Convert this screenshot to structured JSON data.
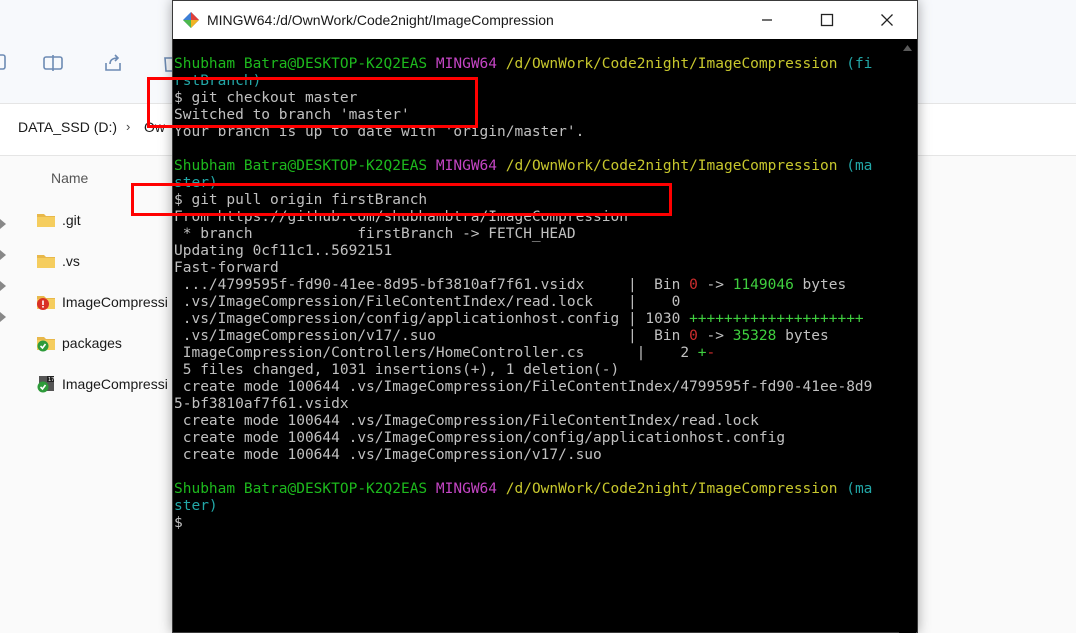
{
  "explorer": {
    "address": {
      "drive": "DATA_SSD (D:)",
      "folder_fragment": "Ow"
    },
    "column_header": "Name",
    "files": [
      {
        "name": ".git",
        "icon": "folder-icon"
      },
      {
        "name": ".vs",
        "icon": "folder-icon"
      },
      {
        "name": "ImageCompressi",
        "icon": "solution-file-error-icon"
      },
      {
        "name": "packages",
        "icon": "folder-synced-icon"
      },
      {
        "name": "ImageCompressi",
        "icon": "vs-solution-icon"
      }
    ]
  },
  "terminal": {
    "title": "MINGW64:/d/OwnWork/Code2night/ImageCompression",
    "colors": {
      "prompt_user": "#1db91d",
      "prompt_env": "#c445c4",
      "prompt_path": "#c7c72d",
      "prompt_branch": "#22a7a7",
      "annotation": "#ff0000"
    },
    "lines": [
      {
        "segs": [
          {
            "t": "Shubham Batra@DESKTOP-K2Q2EAS",
            "c": "c-green"
          },
          {
            "t": " "
          },
          {
            "t": "MINGW64",
            "c": "c-magenta"
          },
          {
            "t": " "
          },
          {
            "t": "/d/OwnWork/Code2night/ImageCompression",
            "c": "c-yellow"
          },
          {
            "t": " "
          },
          {
            "t": "(fi",
            "c": "c-teal"
          }
        ]
      },
      {
        "segs": [
          {
            "t": "rstBranch)",
            "c": "c-teal"
          }
        ]
      },
      {
        "segs": [
          {
            "t": "$ git checkout master"
          }
        ]
      },
      {
        "segs": [
          {
            "t": "Switched to branch 'master'"
          }
        ]
      },
      {
        "segs": [
          {
            "t": "Your branch is up to date with 'origin/master'."
          }
        ]
      },
      {
        "segs": [
          {
            "t": ""
          }
        ]
      },
      {
        "segs": [
          {
            "t": "Shubham Batra@DESKTOP-K2Q2EAS",
            "c": "c-green"
          },
          {
            "t": " "
          },
          {
            "t": "MINGW64",
            "c": "c-magenta"
          },
          {
            "t": " "
          },
          {
            "t": "/d/OwnWork/Code2night/ImageCompression",
            "c": "c-yellow"
          },
          {
            "t": " "
          },
          {
            "t": "(ma",
            "c": "c-teal"
          }
        ]
      },
      {
        "segs": [
          {
            "t": "ster)",
            "c": "c-teal"
          }
        ]
      },
      {
        "segs": [
          {
            "t": "$ git pull origin firstBranch"
          }
        ]
      },
      {
        "segs": [
          {
            "t": "From https://github.com/shubhambtra/ImageCompression"
          }
        ]
      },
      {
        "segs": [
          {
            "t": " * branch            firstBranch -> FETCH_HEAD"
          }
        ]
      },
      {
        "segs": [
          {
            "t": "Updating 0cf11c1..5692151"
          }
        ]
      },
      {
        "segs": [
          {
            "t": "Fast-forward"
          }
        ]
      },
      {
        "segs": [
          {
            "t": " .../4799595f-fd90-41ee-8d95-bf3810af7f61.vsidx     |  Bin "
          },
          {
            "t": "0",
            "c": "c-red"
          },
          {
            "t": " -> "
          },
          {
            "t": "1149046",
            "c": "c-lgreen"
          },
          {
            "t": " bytes"
          }
        ]
      },
      {
        "segs": [
          {
            "t": " .vs/ImageCompression/FileContentIndex/read.lock    |    0"
          }
        ]
      },
      {
        "segs": [
          {
            "t": " .vs/ImageCompression/config/applicationhost.config | 1030 "
          },
          {
            "t": "++++++++++++++++++++",
            "c": "c-lgreen"
          }
        ]
      },
      {
        "segs": [
          {
            "t": " .vs/ImageCompression/v17/.suo                      |  Bin "
          },
          {
            "t": "0",
            "c": "c-red"
          },
          {
            "t": " -> "
          },
          {
            "t": "35328",
            "c": "c-lgreen"
          },
          {
            "t": " bytes"
          }
        ]
      },
      {
        "segs": [
          {
            "t": " ImageCompression/Controllers/HomeController.cs      |    2 "
          },
          {
            "t": "+",
            "c": "c-lgreen"
          },
          {
            "t": "-",
            "c": "c-red"
          }
        ]
      },
      {
        "segs": [
          {
            "t": " 5 files changed, 1031 insertions(+), 1 deletion(-)"
          }
        ]
      },
      {
        "segs": [
          {
            "t": " create mode 100644 .vs/ImageCompression/FileContentIndex/4799595f-fd90-41ee-8d9"
          }
        ]
      },
      {
        "segs": [
          {
            "t": "5-bf3810af7f61.vsidx"
          }
        ]
      },
      {
        "segs": [
          {
            "t": " create mode 100644 .vs/ImageCompression/FileContentIndex/read.lock"
          }
        ]
      },
      {
        "segs": [
          {
            "t": " create mode 100644 .vs/ImageCompression/config/applicationhost.config"
          }
        ]
      },
      {
        "segs": [
          {
            "t": " create mode 100644 .vs/ImageCompression/v17/.suo"
          }
        ]
      },
      {
        "segs": [
          {
            "t": ""
          }
        ]
      },
      {
        "segs": [
          {
            "t": "Shubham Batra@DESKTOP-K2Q2EAS",
            "c": "c-green"
          },
          {
            "t": " "
          },
          {
            "t": "MINGW64",
            "c": "c-magenta"
          },
          {
            "t": " "
          },
          {
            "t": "/d/OwnWork/Code2night/ImageCompression",
            "c": "c-yellow"
          },
          {
            "t": " "
          },
          {
            "t": "(ma",
            "c": "c-teal"
          }
        ]
      },
      {
        "segs": [
          {
            "t": "ster)",
            "c": "c-teal"
          }
        ]
      },
      {
        "segs": [
          {
            "t": "$"
          }
        ]
      }
    ]
  }
}
